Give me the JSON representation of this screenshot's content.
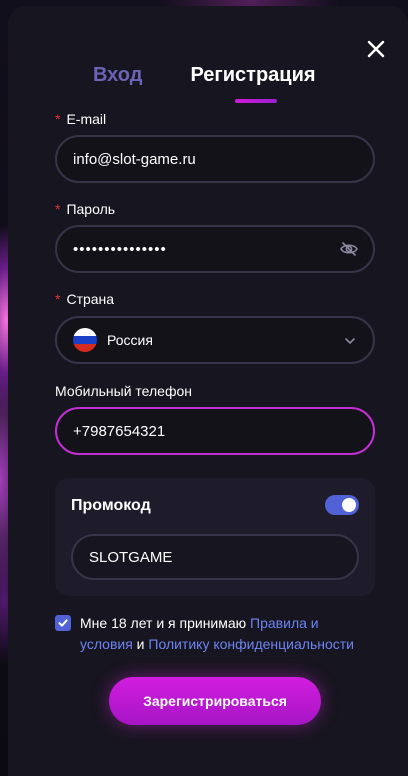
{
  "tabs": {
    "login": "Вход",
    "register": "Регистрация"
  },
  "form": {
    "email": {
      "label": "E-mail",
      "required_mark": "*",
      "value": "info@slot-game.ru"
    },
    "password": {
      "label": "Пароль",
      "required_mark": "*",
      "value": "•••••••••••••••"
    },
    "country": {
      "label": "Страна",
      "required_mark": "*",
      "value": "Россия"
    },
    "phone": {
      "label": "Мобильный телефон",
      "value": "+7987654321"
    }
  },
  "promo": {
    "title": "Промокод",
    "enabled": true,
    "value": "SLOTGAME"
  },
  "agreement": {
    "checked": true,
    "text_before": "Мне 18 лет и я принимаю ",
    "rules_link": "Правила и условия",
    "middle": " и ",
    "privacy_link": "Политику конфиденциальности"
  },
  "submit_label": "Зарегистрироваться",
  "colors": {
    "accent": "#c32fd3",
    "link": "#6e84f2",
    "toggle": "#5062d6",
    "required": "#e0303c"
  },
  "icons": {
    "close": "close-icon",
    "eye": "eye-off-icon",
    "chevron": "chevron-down-icon",
    "flag": "russia-flag-icon"
  }
}
